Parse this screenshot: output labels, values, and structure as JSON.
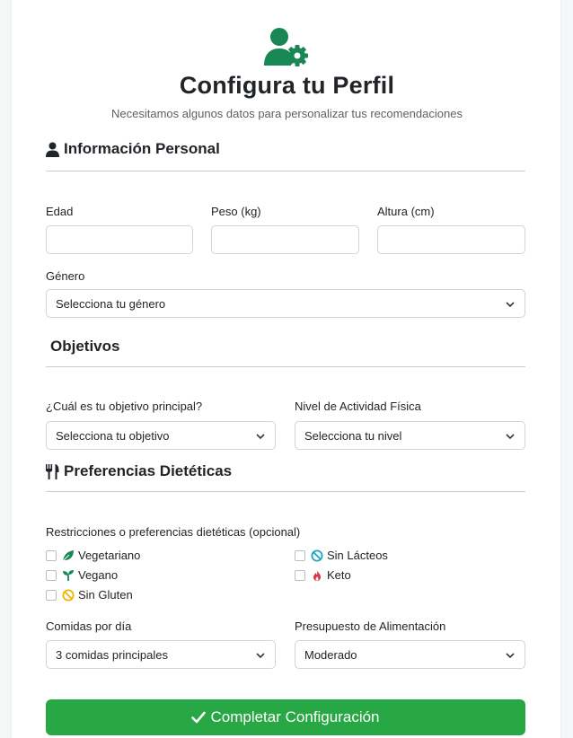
{
  "header": {
    "icon": "user-gear-icon",
    "title": "Configura tu Perfil",
    "subtitle": "Necesitamos algunos datos para personalizar tus recomendaciones"
  },
  "personal": {
    "title": "Información Personal",
    "icon": "user-icon",
    "age_label": "Edad",
    "weight_label": "Peso (kg)",
    "height_label": "Altura (cm)",
    "gender_label": "Género",
    "gender_value": "Selecciona tu género"
  },
  "objectives": {
    "title": "Objetivos",
    "goal_label": "¿Cuál es tu objetivo principal?",
    "goal_value": "Selecciona tu objetivo",
    "activity_label": "Nivel de Actividad Física",
    "activity_value": "Selecciona tu nivel"
  },
  "diet": {
    "title": "Preferencias Dietéticas",
    "icon": "utensils-icon",
    "restrictions_label": "Restricciones o preferencias dietéticas (opcional)",
    "options": [
      {
        "label": "Vegetariano",
        "icon": "leaf-icon",
        "checked": false
      },
      {
        "label": "Vegano",
        "icon": "seedling-icon",
        "checked": false
      },
      {
        "label": "Sin Gluten",
        "icon": "ban-icon",
        "checked": false
      },
      {
        "label": "Sin Lácteos",
        "icon": "ban-icon",
        "checked": false
      },
      {
        "label": "Keto",
        "icon": "fire-icon",
        "checked": false
      }
    ],
    "meals_label": "Comidas por día",
    "meals_value": "3 comidas principales",
    "budget_label": "Presupuesto de Alimentación",
    "budget_value": "Moderado"
  },
  "submit": {
    "label": "Completar Configuración",
    "icon": "check-icon"
  },
  "colors": {
    "brand_green": "#198754",
    "button_green": "#28a745"
  }
}
